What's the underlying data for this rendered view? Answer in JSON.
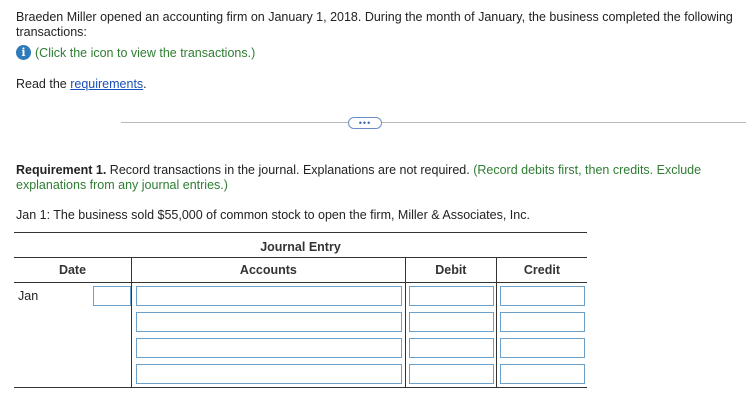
{
  "intro": {
    "text": "Braeden Miller opened an accounting firm on January 1, 2018. During the month of January, the business completed the following transactions:",
    "info_link": "(Click the icon to view the transactions.)",
    "read_prefix": "Read the ",
    "read_link": "requirements",
    "read_suffix": "."
  },
  "more_button_glyph": "•••",
  "requirement": {
    "bold": "Requirement 1.",
    "text": " Record transactions in the journal. Explanations are not required. ",
    "green": "(Record debits first, then credits. Exclude explanations from any journal entries.)"
  },
  "transaction": "Jan 1: The business sold $55,000 of common stock to open the firm, Miller & Associates, Inc.",
  "journal": {
    "title": "Journal Entry",
    "headers": {
      "date": "Date",
      "accounts": "Accounts",
      "debit": "Debit",
      "credit": "Credit"
    },
    "month": "Jan",
    "rows": [
      {
        "day": "",
        "account": "",
        "debit": "",
        "credit": ""
      },
      {
        "account": "",
        "debit": "",
        "credit": ""
      },
      {
        "account": "",
        "debit": "",
        "credit": ""
      },
      {
        "account": "",
        "debit": "",
        "credit": ""
      }
    ]
  },
  "colors": {
    "link": "#1a4fb8",
    "green_note": "#2e7d32",
    "input_border": "#6aa0c9",
    "info_icon": "#2f7ab8"
  }
}
